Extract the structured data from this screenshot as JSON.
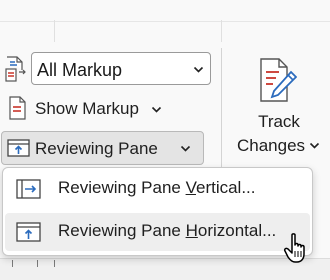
{
  "display_for_review": {
    "selected_value": "All Markup",
    "icon": "markup-document-icon"
  },
  "show_markup": {
    "label": "Show Markup",
    "icon": "show-markup-icon"
  },
  "reviewing_pane": {
    "label": "Reviewing Pane",
    "icon": "reviewing-pane-icon"
  },
  "track_changes": {
    "label_line1": "Track",
    "label_line2": "Changes",
    "icon": "track-changes-pencil-icon"
  },
  "menu": {
    "items": [
      {
        "prefix": "Reviewing Pane ",
        "hotkey": "V",
        "suffix": "ertical...",
        "icon": "pane-vertical-icon"
      },
      {
        "prefix": "Reviewing Pane ",
        "hotkey": "H",
        "suffix": "orizontal...",
        "icon": "pane-horizontal-icon"
      }
    ],
    "hovered_index": 1
  },
  "colors": {
    "accent_blue": "#2b6bbd",
    "accent_red": "#c8352b",
    "menu_hover": "#eeeeee",
    "button_active": "#e4e4e4"
  }
}
